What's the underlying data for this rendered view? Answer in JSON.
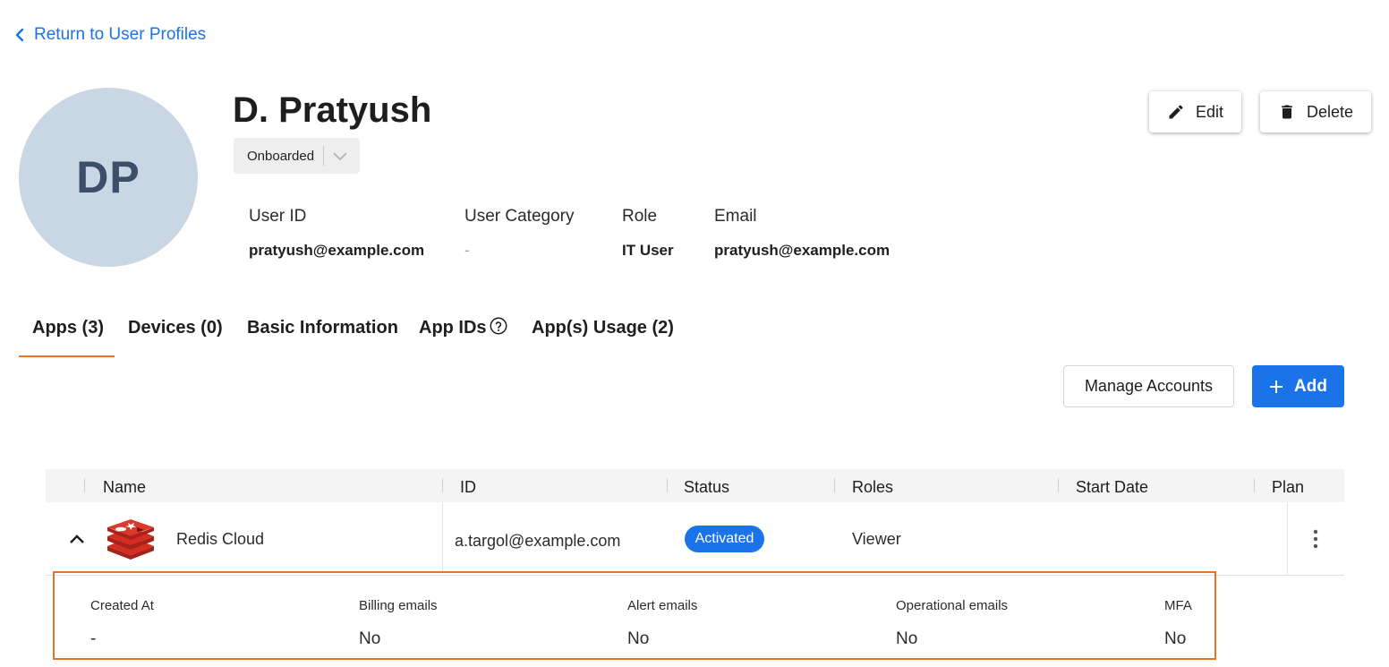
{
  "back_link": {
    "label": "Return to User Profiles"
  },
  "profile": {
    "initials": "DP",
    "name": "D. Pratyush",
    "status": "Onboarded",
    "fields": [
      {
        "label": "User ID",
        "value": "pratyush@example.com"
      },
      {
        "label": "User Category",
        "value": "-"
      },
      {
        "label": "Role",
        "value": "IT User"
      },
      {
        "label": "Email",
        "value": "pratyush@example.com"
      }
    ]
  },
  "actions": {
    "edit_label": "Edit",
    "delete_label": "Delete"
  },
  "tabs": [
    {
      "label": "Apps (3)",
      "active": true
    },
    {
      "label": "Devices (0)",
      "active": false
    },
    {
      "label": "Basic Information",
      "active": false
    },
    {
      "label": "App IDs",
      "active": false,
      "icon": "help-circle-icon"
    },
    {
      "label": "App(s) Usage (2)",
      "active": false
    }
  ],
  "toolbar": {
    "manage_label": "Manage Accounts",
    "add_label": "Add"
  },
  "table": {
    "columns": [
      "Name",
      "ID",
      "Status",
      "Roles",
      "Start Date",
      "Plan"
    ],
    "rows": [
      {
        "name": "Redis Cloud",
        "icon": "redis-logo-icon",
        "id": "a.targol@example.com",
        "status": "Activated",
        "roles": "Viewer",
        "start_date": "",
        "plan": ""
      }
    ],
    "details": [
      {
        "label": "Created At",
        "value": "-"
      },
      {
        "label": "Billing emails",
        "value": "No"
      },
      {
        "label": "Alert emails",
        "value": "No"
      },
      {
        "label": "Operational emails",
        "value": "No"
      },
      {
        "label": "MFA",
        "value": "No"
      }
    ]
  },
  "colors": {
    "accent": "#1a73e8",
    "tab_underline": "#e8742c",
    "avatar_bg": "#c9d6e4",
    "highlight_border": "#e8742c"
  }
}
